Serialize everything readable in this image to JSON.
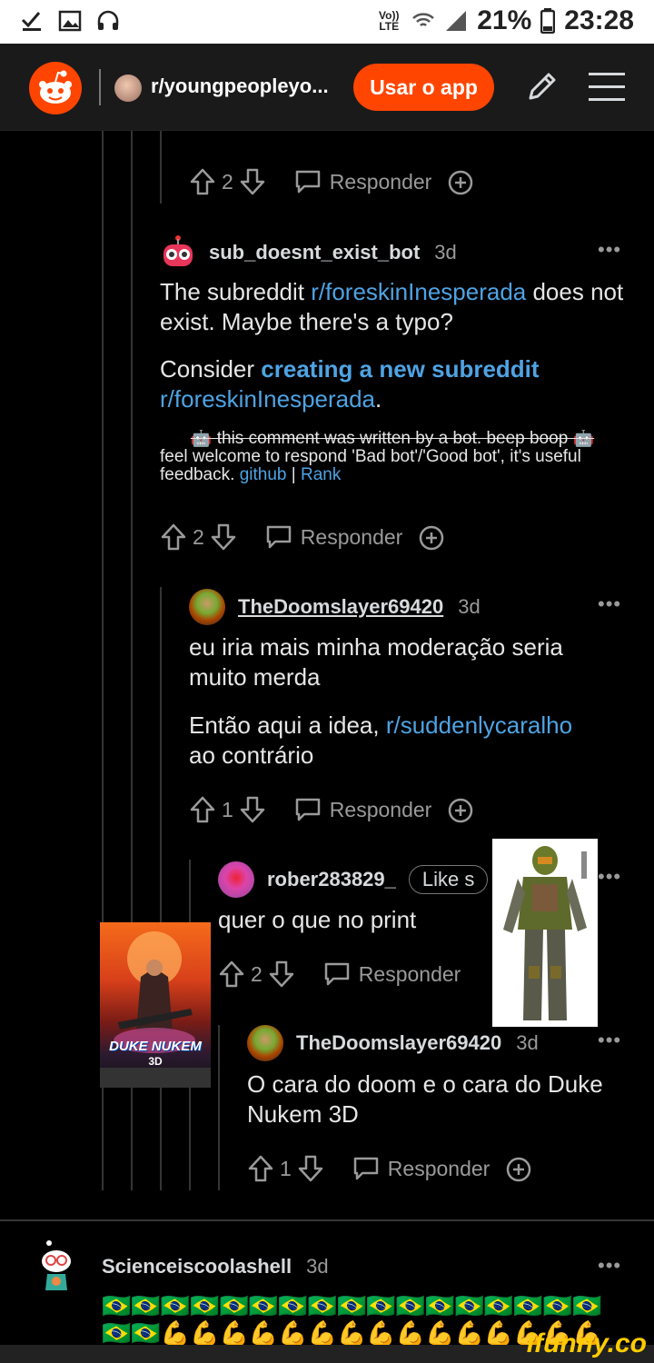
{
  "status_bar": {
    "network": "Vo)) LTE",
    "battery": "21%",
    "time": "23:28"
  },
  "header": {
    "subreddit": "r/youngpeopleyo...",
    "use_app_label": "Usar o app"
  },
  "top_actions": {
    "votes": "2",
    "reply_label": "Responder"
  },
  "comments": [
    {
      "user": "sub_doesnt_exist_bot",
      "time": "3d",
      "body_1_pre": "The subreddit ",
      "body_1_link": "r/foreskinInesperada",
      "body_1_post": " does not exist. Maybe there's a typo?",
      "body_2_pre": "Consider ",
      "body_2_bold_link": "creating a new subreddit",
      "body_2_link": "r/foreskinInesperada",
      "body_2_post": ".",
      "footer_strike": "🤖 this comment was written by a bot. beep boop 🤖",
      "footer_text": "feel welcome to respond 'Bad bot'/'Good bot', it's useful feedback.",
      "footer_link1": "github",
      "footer_sep": " | ",
      "footer_link2": "Rank",
      "votes": "2",
      "reply_label": "Responder"
    },
    {
      "user": "TheDoomslayer69420",
      "time": "3d",
      "body_1": "eu iria mais minha moderação seria muito merda",
      "body_2_pre": "Então aqui a idea, ",
      "body_2_link": "r/suddenlycaralho",
      "body_2_post": " ao contrário",
      "votes": "1",
      "reply_label": "Responder"
    },
    {
      "user": "rober283829_",
      "flair": "Like s",
      "body_1": "quer o que no print",
      "votes": "2",
      "reply_label": "Responder"
    },
    {
      "user": "TheDoomslayer69420",
      "time": "3d",
      "body_1": "O cara do doom e o cara do Duke Nukem 3D",
      "votes": "1",
      "reply_label": "Responder"
    },
    {
      "user": "Scienceiscoolashell",
      "time": "3d",
      "emoji_row_1": "🇧🇷🇧🇷🇧🇷🇧🇷🇧🇷🇧🇷🇧🇷🇧🇷🇧🇷🇧🇷🇧🇷🇧🇷🇧🇷🇧🇷🇧🇷🇧🇷🇧🇷",
      "emoji_row_2": "🇧🇷🇧🇷💪💪💪💪💪💪💪💪💪💪💪💪💪💪💪"
    }
  ],
  "overlay_images": {
    "duke_poster_title": "DUKE NUKEM",
    "duke_poster_sub": "3D"
  },
  "watermark": "ifunny.co",
  "more_label": "•••"
}
